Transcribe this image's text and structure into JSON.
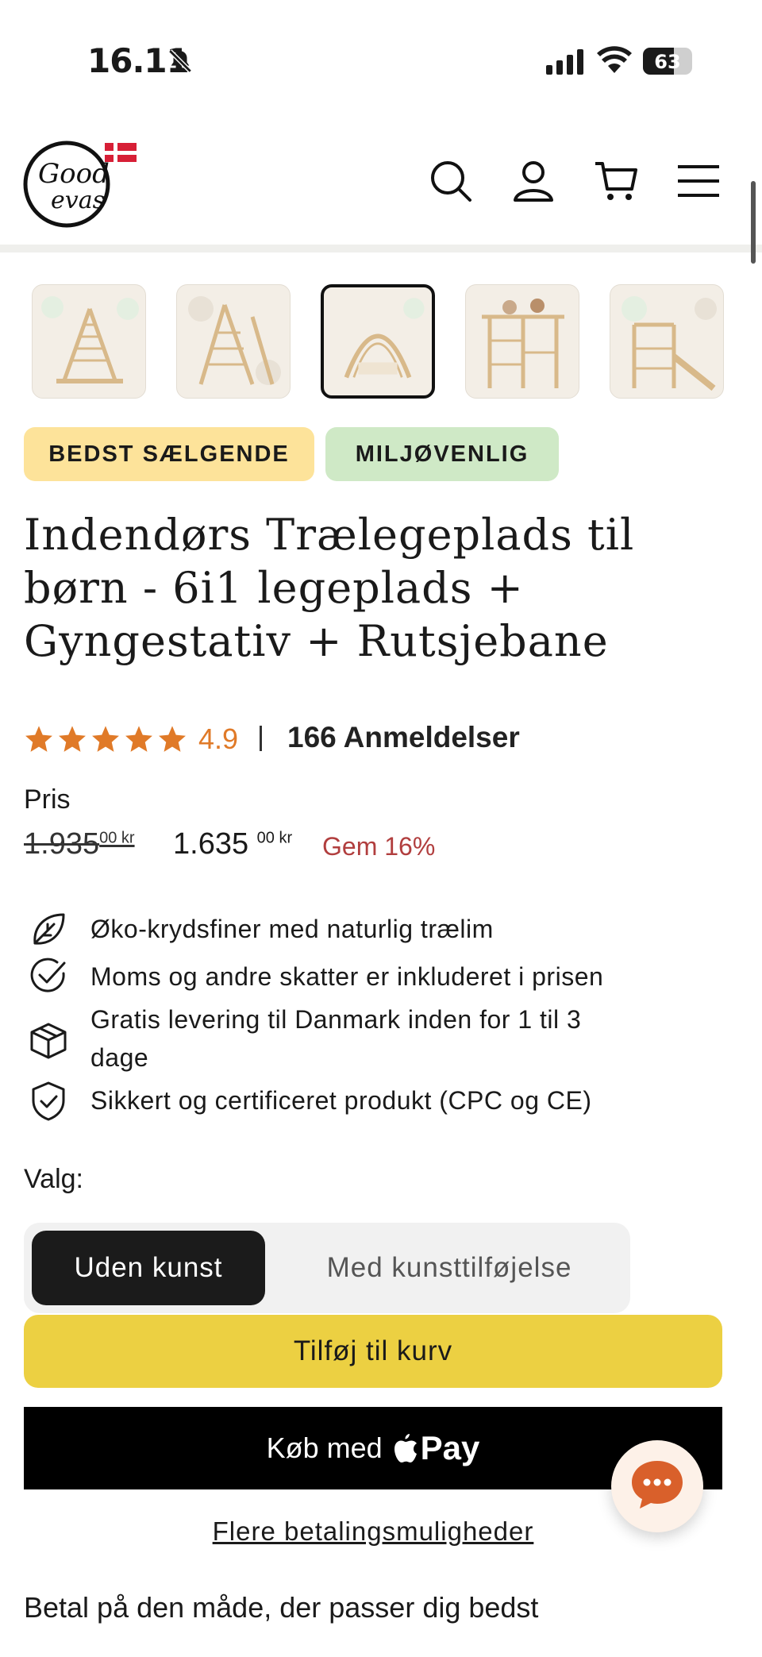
{
  "status_bar": {
    "time": "16.11",
    "battery": "63",
    "battery_level": 0.63
  },
  "header": {
    "logo_text_line1": "Good",
    "logo_text_line2": "evas"
  },
  "thumbnails": [
    {
      "label": "product-thumbnail-1"
    },
    {
      "label": "product-thumbnail-2"
    },
    {
      "label": "product-thumbnail-3",
      "selected": true
    },
    {
      "label": "product-thumbnail-4"
    },
    {
      "label": "product-thumbnail-5"
    }
  ],
  "badges": {
    "bestseller": {
      "label": "BEDST SÆLGENDE",
      "color": "#fde39a"
    },
    "eco": {
      "label": "MILJØVENLIG",
      "color": "#cfe9c6"
    }
  },
  "product": {
    "title_line1": "Indendørs Trælegeplads til",
    "title_line2": "børn - 6i1 legeplads +",
    "title_line3": "Gyngestativ + Rutsjebane",
    "rating": "4.9",
    "rating_stars": 5,
    "reviews": "166 Anmeldelser",
    "price_label": "Pris",
    "old_price_main": "1.935",
    "old_price_sup": "00 kr",
    "new_price_main": "1.635",
    "new_price_sup": "00 kr",
    "save_text": "Gem 16%"
  },
  "features": [
    {
      "icon": "leaf-icon",
      "text": "Øko-krydsfiner med naturlig trælim"
    },
    {
      "icon": "check-circle-icon",
      "text": "Moms og andre skatter er inkluderet i prisen"
    },
    {
      "icon": "package-icon",
      "text_line1": "Gratis levering til Danmark inden for 1 til 3",
      "text_line2": "dage"
    },
    {
      "icon": "shield-check-icon",
      "text": "Sikkert og certificeret produkt (CPC og CE)"
    }
  ],
  "options": {
    "label": "Valg:",
    "selected": "Uden kunst",
    "other": "Med kunsttilføjelse"
  },
  "actions": {
    "add_to_cart": "Tilføj til kurv",
    "apple_pay_prefix": "Køb med",
    "apple_pay_word": "Pay",
    "more_payment": "Flere betalingsmuligheder"
  },
  "footer_text": "Betal på den måde, der passer dig bedst",
  "colors": {
    "accent_yellow": "#ecd042",
    "rating_orange": "#e07a28",
    "save_red": "#b13e3e"
  }
}
